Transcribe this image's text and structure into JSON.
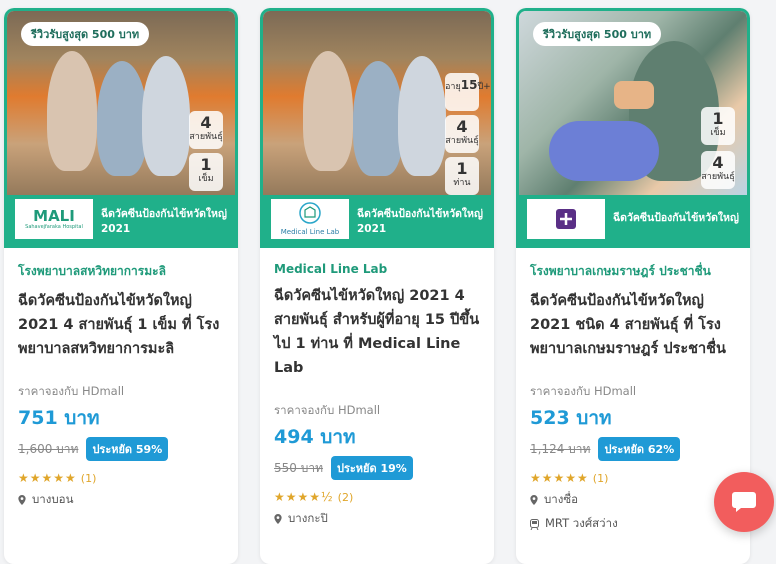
{
  "cards": [
    {
      "badge": "รีวิวรับสูงสุด 500 บาท",
      "pill_top": {
        "value": "4",
        "label": "สายพันธุ์"
      },
      "pill_bottom": {
        "value": "1",
        "label": "เข็ม"
      },
      "logo_text": "MALI",
      "logo_sub": "Sahavejfaraka Hospital",
      "strip_text": "ฉีดวัคซีนป้องกันไข้หวัดใหญ่",
      "strip_year": "2021",
      "hospital": "โรงพยาบาลสหวิทยาการมะลิ",
      "title": "ฉีดวัคซีนป้องกันไข้หวัดใหญ่ 2021 4 สายพันธุ์ 1 เข็ม ที่ โรงพยาบาลสหวิทยาการมะลิ",
      "price_label": "ราคาจองกับ HDmall",
      "price": "751 บาท",
      "old_price": "1,600 บาท",
      "discount": "ประหยัด 59%",
      "stars": "★★★★★",
      "rating_count": "(1)",
      "location": "บางบอน"
    },
    {
      "pill_age": {
        "value": "15",
        "label": "อายุ",
        "suffix": "ปี+"
      },
      "pill_top": {
        "value": "4",
        "label": "สายพันธุ์"
      },
      "pill_bottom": {
        "value": "1",
        "label": "ท่าน"
      },
      "logo_text": "Medical Line Lab",
      "strip_text": "ฉีดวัคซีนป้องกันไข้หวัดใหญ่",
      "strip_year": "2021",
      "hospital": "Medical Line Lab",
      "title": "ฉีดวัคซีนไข้หวัดใหญ่ 2021 4 สายพันธุ์ สำหรับผู้ที่อายุ 15 ปีขึ้นไป 1 ท่าน ที่ Medical Line Lab",
      "price_label": "ราคาจองกับ HDmall",
      "price": "494 บาท",
      "old_price": "550 บาท",
      "discount": "ประหยัด 19%",
      "stars": "★★★★½",
      "rating_count": "(2)",
      "location": "บางกะปิ"
    },
    {
      "badge": "รีวิวรับสูงสุด 500 บาท",
      "pill_top": {
        "value": "1",
        "label": "เข็ม"
      },
      "pill_bottom": {
        "value": "4",
        "label": "สายพันธุ์"
      },
      "strip_text": "ฉีดวัคซีนป้องกันไข้หวัดใหญ่",
      "hospital": "โรงพยาบาลเกษมราษฎร์ ประชาชื่น",
      "title": "ฉีดวัคซีนป้องกันไข้หวัดใหญ่ 2021 ชนิด 4 สายพันธุ์ ที่ โรงพยาบาลเกษมราษฎร์ ประชาชื่น",
      "price_label": "ราคาจองกับ HDmall",
      "price": "523 บาท",
      "old_price": "1,124 บาท",
      "discount": "ประหยัด 62%",
      "stars": "★★★★★",
      "rating_count": "(1)",
      "location": "บางซื่อ",
      "transit": "MRT วงศ์สว่าง"
    }
  ],
  "colors": {
    "accent": "#20b08a",
    "price": "#1f9ad6",
    "chat": "#f25d5d"
  }
}
